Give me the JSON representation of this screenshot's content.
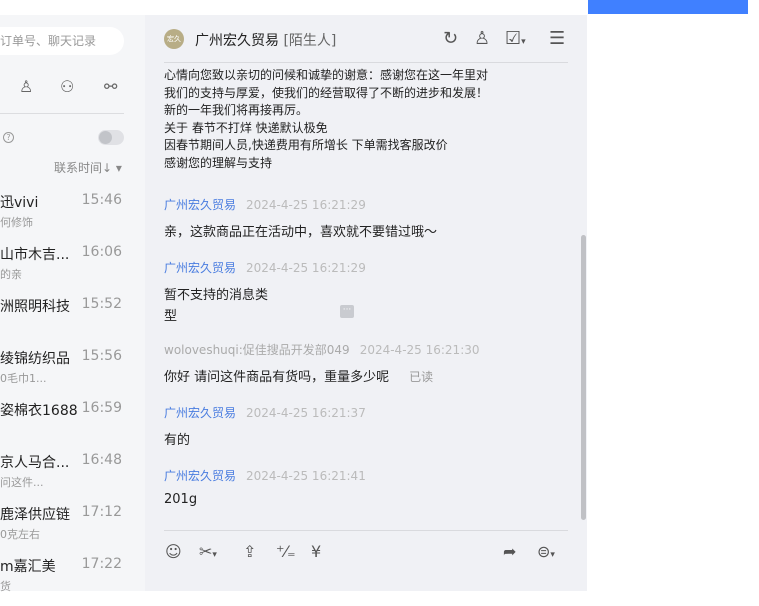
{
  "sidebar": {
    "search_placeholder": "订单号、聊天记录",
    "sort_label": "联系时间↓ ▾",
    "contacts": [
      {
        "name": "迅vivi",
        "time": "15:46",
        "preview": "何修饰"
      },
      {
        "name": "山市木吉...",
        "time": "16:06",
        "preview": "的亲"
      },
      {
        "name": "洲照明科技",
        "time": "15:52",
        "preview": ""
      },
      {
        "name": "绫锦纺织品",
        "time": "15:56",
        "preview": "0毛巾1..."
      },
      {
        "name": "姿棉衣1688",
        "time": "16:59",
        "preview": ""
      },
      {
        "name": "京人马合...",
        "time": "16:48",
        "preview": "问这件..."
      },
      {
        "name": "鹿泽供应链",
        "time": "17:12",
        "preview": "0克左右"
      },
      {
        "name": "m嘉汇美",
        "time": "17:22",
        "preview": "货"
      }
    ]
  },
  "chat": {
    "title": "广州宏久贸易",
    "tag": "[陌生人]",
    "avatar_text": "宏久",
    "notice_lines": [
      "心情向您致以亲切的问候和诚挚的谢意：感谢您在这一年里对",
      "我们的支持与厚爱，使我们的经营取得了不断的进步和发展！",
      "新的一年我们将再接再厉。",
      "关于 春节不打烊    快递默认极免",
      "因春节期间人员,快递费用有所增长 下单需找客服改价",
      "感谢您的理解与支持"
    ],
    "messages": [
      {
        "sender": "广州宏久贸易",
        "time": "2024-4-25 16:21:29",
        "text": "亲，这款商品正在活动中，喜欢就不要错过哦～"
      },
      {
        "sender": "广州宏久贸易",
        "time": "2024-4-25 16:21:29",
        "text": "暂不支持的消息类",
        "text2": "型"
      },
      {
        "sender": "woloveshuqi:促佳搜品开发部049",
        "time": "2024-4-25 16:21:30",
        "text": "你好 请问这件商品有货吗，重量多少呢",
        "status": "已读"
      },
      {
        "sender": "广州宏久贸易",
        "time": "2024-4-25 16:21:37",
        "text": "有的"
      },
      {
        "sender": "广州宏久贸易",
        "time": "2024-4-25 16:21:41",
        "text": "201g"
      }
    ]
  },
  "colors": {
    "accent": "#4080ff",
    "sender": "#4a7de0"
  }
}
